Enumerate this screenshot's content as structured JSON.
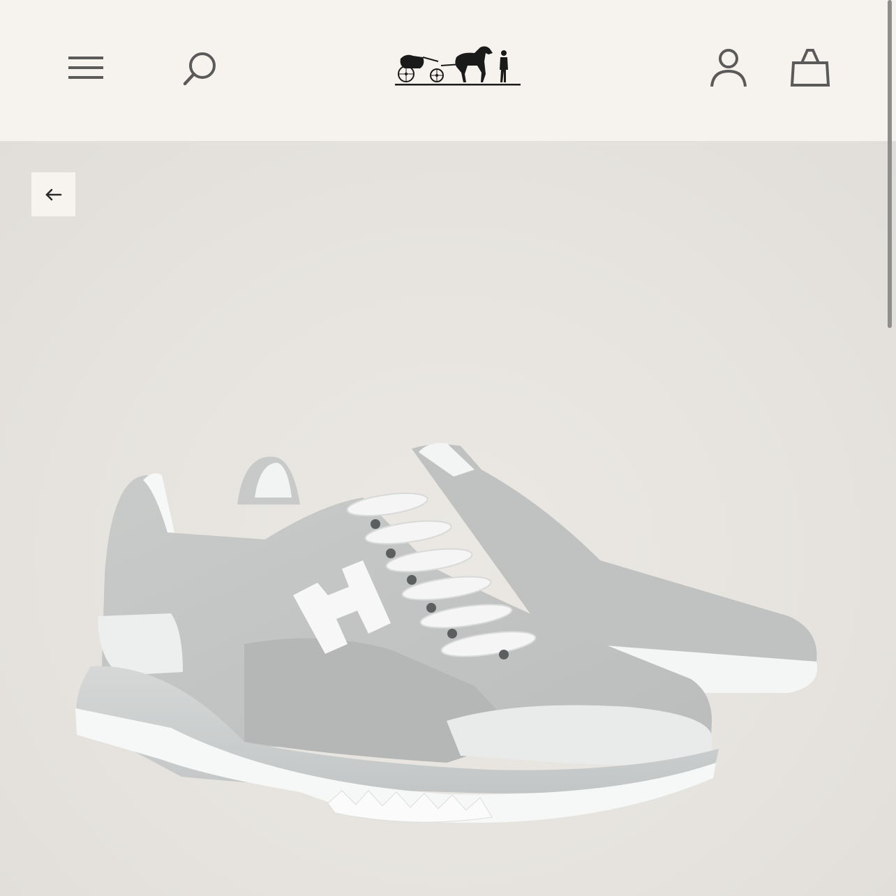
{
  "header": {
    "menu_icon": "hamburger-menu-icon",
    "search_icon": "search-icon",
    "logo": "carriage-logo",
    "account_icon": "user-account-icon",
    "bag_icon": "shopping-bag-icon"
  },
  "gallery": {
    "back_icon": "arrow-left-icon",
    "image_subject": "product-photo"
  },
  "colors": {
    "header_bg": "#f6f2ed",
    "page_bg": "#e7e4df",
    "icon_color": "#5a5a5a"
  }
}
